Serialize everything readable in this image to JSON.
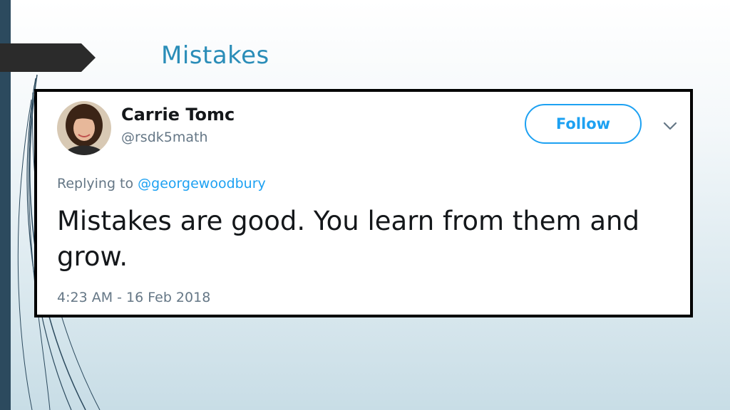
{
  "slide": {
    "title": "Mistakes"
  },
  "tweet": {
    "display_name": "Carrie Tomc",
    "handle": "@rsdk5math",
    "follow_label": "Follow",
    "replying_prefix": "Replying to",
    "replying_to": "@georgewoodbury",
    "text": "Mistakes are good. You learn from them and grow.",
    "timestamp": "4:23 AM - 16 Feb 2018"
  },
  "colors": {
    "accent_blue": "#1da1f2",
    "title_blue": "#2a8db8",
    "sidebar_dark": "#2c4a5e"
  },
  "icons": {
    "avatar": "user-photo",
    "menu": "chevron-down-icon"
  }
}
